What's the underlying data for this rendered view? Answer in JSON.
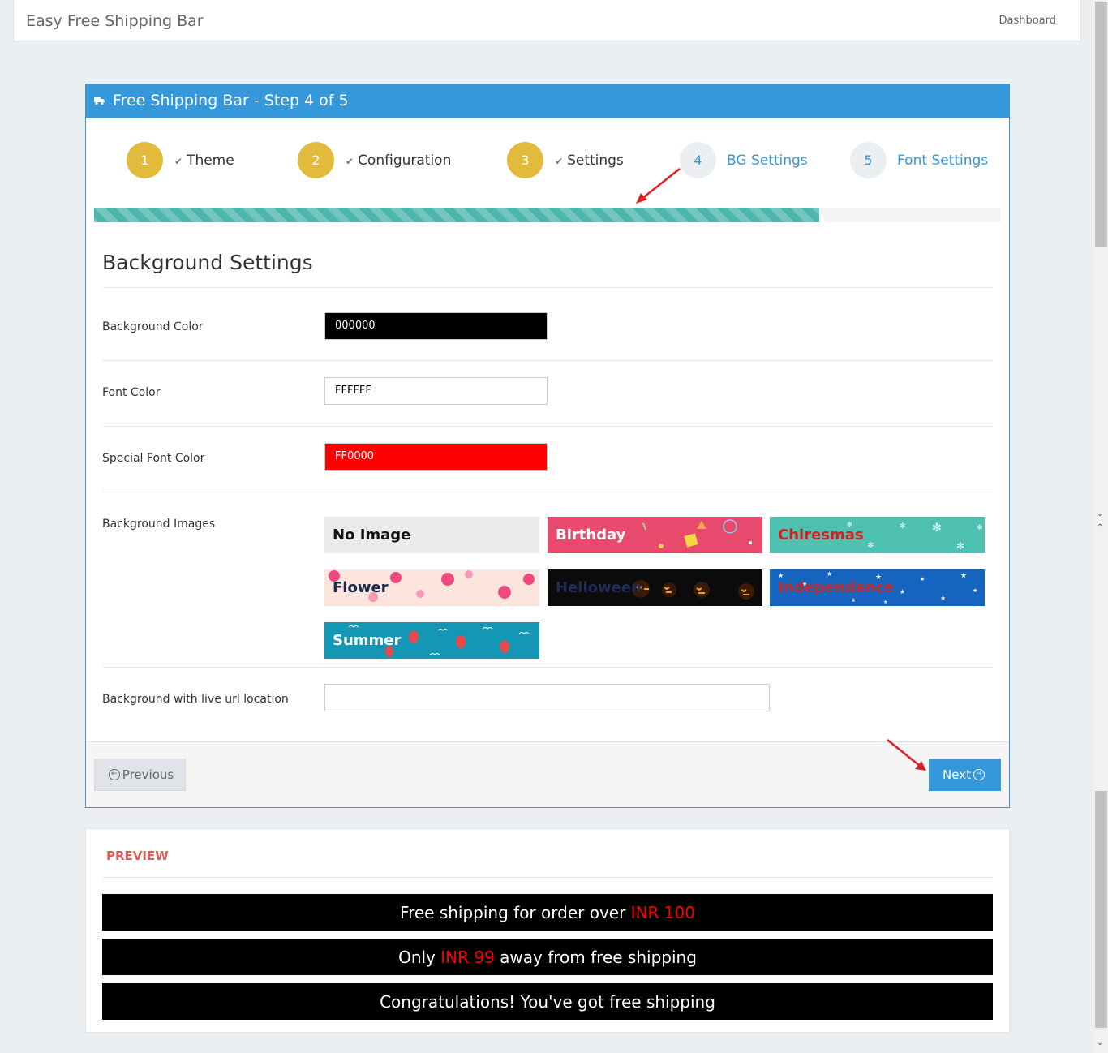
{
  "topbar": {
    "title": "Easy Free Shipping Bar",
    "dashboard": "Dashboard"
  },
  "wizard": {
    "heading": "Free Shipping Bar - Step 4 of 5",
    "steps": [
      {
        "num": "1",
        "label": "Theme",
        "done": true
      },
      {
        "num": "2",
        "label": "Configuration",
        "done": true
      },
      {
        "num": "3",
        "label": "Settings",
        "done": true
      },
      {
        "num": "4",
        "label": "BG Settings",
        "done": false
      },
      {
        "num": "5",
        "label": "Font Settings",
        "done": false
      }
    ],
    "progress_fraction": 0.8
  },
  "bg_settings": {
    "title": "Background Settings",
    "background_color": {
      "label": "Background Color",
      "value": "000000",
      "hex": "#000000",
      "text_hex": "#ffffff"
    },
    "font_color": {
      "label": "Font Color",
      "value": "FFFFFF",
      "hex": "#ffffff",
      "text_hex": "#000000"
    },
    "special_font_color": {
      "label": "Special Font Color",
      "value": "FF0000",
      "hex": "#ff0000",
      "text_hex": "#ffffff"
    },
    "images_label": "Background Images",
    "images": [
      {
        "name": "No Image",
        "bg": "#ebebeb",
        "text": "#111111"
      },
      {
        "name": "Birthday",
        "bg": "#e84a6d",
        "text": "#ffffff"
      },
      {
        "name": "Chiresmas",
        "bg": "#4fc1b1",
        "text": "#d32020"
      },
      {
        "name": "Flower",
        "bg": "#fce5dc",
        "text": "#1b2a4a"
      },
      {
        "name": "Helloween",
        "bg": "#0b0b0b",
        "text": "#1f2d57"
      },
      {
        "name": "Independance",
        "bg": "#1565c0",
        "text": "#c62828"
      },
      {
        "name": "Summer",
        "bg": "#1497b5",
        "text": "#ffffff"
      }
    ],
    "live_url_label": "Background with live url location",
    "live_url_value": ""
  },
  "footer": {
    "previous": "Previous",
    "next": "Next"
  },
  "preview": {
    "title": "PREVIEW",
    "bars": [
      {
        "before": "Free shipping for order over ",
        "special": "INR 100",
        "after": ""
      },
      {
        "before": "Only ",
        "special": "INR 99",
        "after": " away from free shipping"
      },
      {
        "before": "Congratulations! You've got free shipping",
        "special": "",
        "after": ""
      }
    ]
  },
  "colors": {
    "primary": "#3498db",
    "step_done": "#e3bb3c",
    "progress": "#4db6ac",
    "arrow": "#e02020"
  }
}
